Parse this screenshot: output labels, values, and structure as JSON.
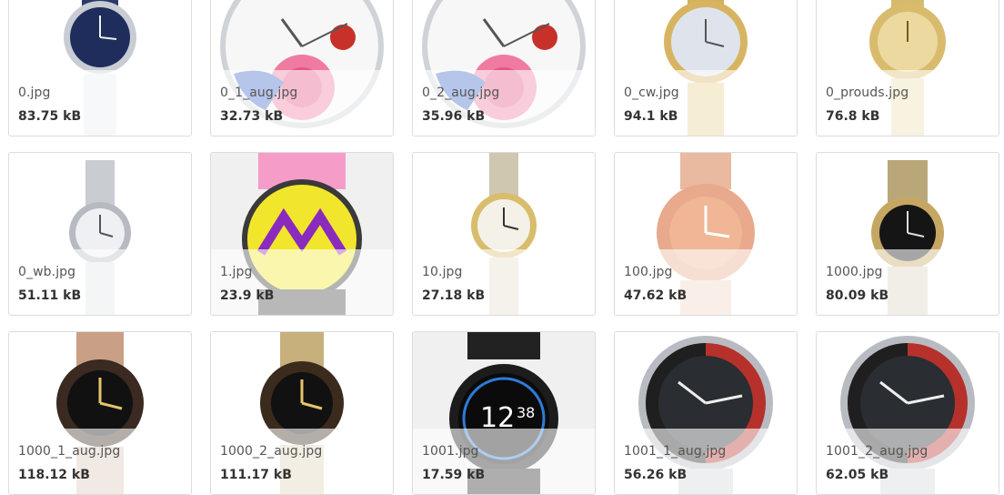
{
  "files": [
    {
      "name": "0.jpg",
      "size": "83.75 kB",
      "icon": "watch-blue-dial-icon"
    },
    {
      "name": "0_1_aug.jpg",
      "size": "32.73 kB",
      "icon": "watch-rose-dial-icon"
    },
    {
      "name": "0_2_aug.jpg",
      "size": "35.96 kB",
      "icon": "watch-rose-dial-icon"
    },
    {
      "name": "0_cw.jpg",
      "size": "94.1 kB",
      "icon": "watch-gold-pearl-icon"
    },
    {
      "name": "0_prouds.jpg",
      "size": "76.8 kB",
      "icon": "watch-gold-icon"
    },
    {
      "name": "0_wb.jpg",
      "size": "51.11 kB",
      "icon": "watch-silver-icon"
    },
    {
      "name": "1.jpg",
      "size": "23.9 kB",
      "icon": "watch-swatch-yellow-icon"
    },
    {
      "name": "10.jpg",
      "size": "27.18 kB",
      "icon": "watch-two-tone-icon"
    },
    {
      "name": "100.jpg",
      "size": "47.62 kB",
      "icon": "watch-rose-gold-icon"
    },
    {
      "name": "1000.jpg",
      "size": "80.09 kB",
      "icon": "watch-black-dial-icon"
    },
    {
      "name": "1000_1_aug.jpg",
      "size": "118.12 kB",
      "icon": "watch-gmt-rosegold-icon"
    },
    {
      "name": "1000_2_aug.jpg",
      "size": "111.17 kB",
      "icon": "watch-gmt-gold-icon"
    },
    {
      "name": "1001.jpg",
      "size": "17.59 kB",
      "icon": "smartwatch-icon"
    },
    {
      "name": "1001_1_aug.jpg",
      "size": "56.26 kB",
      "icon": "watch-diver-red-icon"
    },
    {
      "name": "1001_2_aug.jpg",
      "size": "62.05 kB",
      "icon": "watch-diver-red-icon"
    }
  ]
}
